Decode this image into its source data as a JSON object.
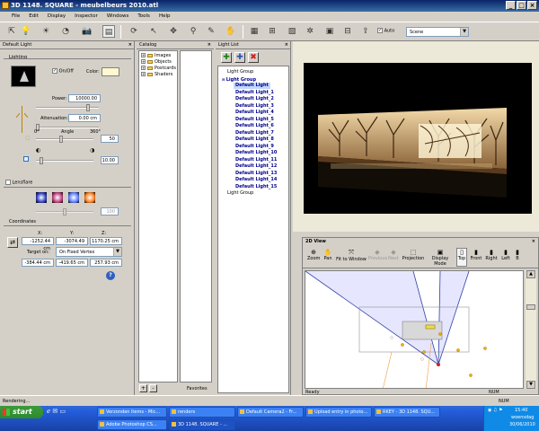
{
  "window": {
    "title": "3D 1148. SQUARE - meubelbeurs 2010.atl",
    "minimize": "_",
    "maximize": "□",
    "close": "×"
  },
  "menu": [
    "File",
    "Edit",
    "Display",
    "Inspector",
    "Windows",
    "Tools",
    "Help"
  ],
  "toolbar": {
    "auto_label": "Auto",
    "scene_value": "Scene"
  },
  "light_panel": {
    "header": "Default Light",
    "lighting_label": "Lighting",
    "onoff_label": "On/Off",
    "color_label": "Color:",
    "power_label": "Power:",
    "power_value": "10000.00",
    "attenuation_label": "Attenuation:",
    "attenuation_value": "0.00 cm",
    "angle_min": "0°",
    "angle_label": "Angle",
    "angle_max": "360°",
    "angle_value": "50",
    "falloff_value": "10.00",
    "lensflare_label": "Lensflare",
    "lensflare_value": "100",
    "coordinates_label": "Coordinates",
    "x_label": "X:",
    "y_label": "Y:",
    "z_label": "Z:",
    "pos_x": "-1252.44 cm",
    "pos_y": "-3074.49 cm",
    "pos_z": "1170.25 cm",
    "target_label": "Target on:",
    "target_value": "On Fixed Vertex",
    "tgt_x": "-384.44 cm",
    "tgt_y": "-419.65 cm",
    "tgt_z": "257.93 cm",
    "help": "?"
  },
  "catalog": {
    "header": "Catalog",
    "items": [
      "Images",
      "Objects",
      "Postcards",
      "Shaders"
    ],
    "favorites_label": "Favorites",
    "add": "+",
    "remove": "-"
  },
  "light_list": {
    "header": "Light List",
    "top_group": "Light Group",
    "group": "Light Group",
    "lights": [
      "Default Light",
      "Default Light_1",
      "Default Light_2",
      "Default Light_3",
      "Default Light_4",
      "Default Light_5",
      "Default Light_6",
      "Default Light_7",
      "Default Light_8",
      "Default Light_9",
      "Default Light_10",
      "Default Light_11",
      "Default Light_12",
      "Default Light_13",
      "Default Light_14",
      "Default Light_15"
    ],
    "bottom_group": "Light Group"
  },
  "view2d": {
    "title": "2D View",
    "tools": [
      "Zoom",
      "Pan",
      "Fit to Window",
      "Previous",
      "Next",
      "Projection",
      "Display Mode",
      "Top",
      "Front",
      "Right",
      "Left",
      "B"
    ],
    "status_left": "Ready",
    "status_right": "NUM"
  },
  "statusbar": {
    "text": "Rendering...",
    "num": "NUM"
  },
  "taskbar": {
    "start": "start",
    "tasks_row1": [
      "Verzonden items - Mic...",
      "renders",
      "Default Camera2 - Fr...",
      "Upload entry in photo...",
      "RKEY - 3D 1148. SQU..."
    ],
    "tasks_row2": [
      "Adobe Photoshop CS...",
      "3D 1148. SQUARE - ..."
    ],
    "time": "15:40",
    "day": "woensdag",
    "date": "30/06/2010"
  },
  "colors": {
    "selection": "#00008b",
    "title_bar": "#0a246a",
    "taskbar": "#245edb",
    "start": "#2d8a2d"
  }
}
